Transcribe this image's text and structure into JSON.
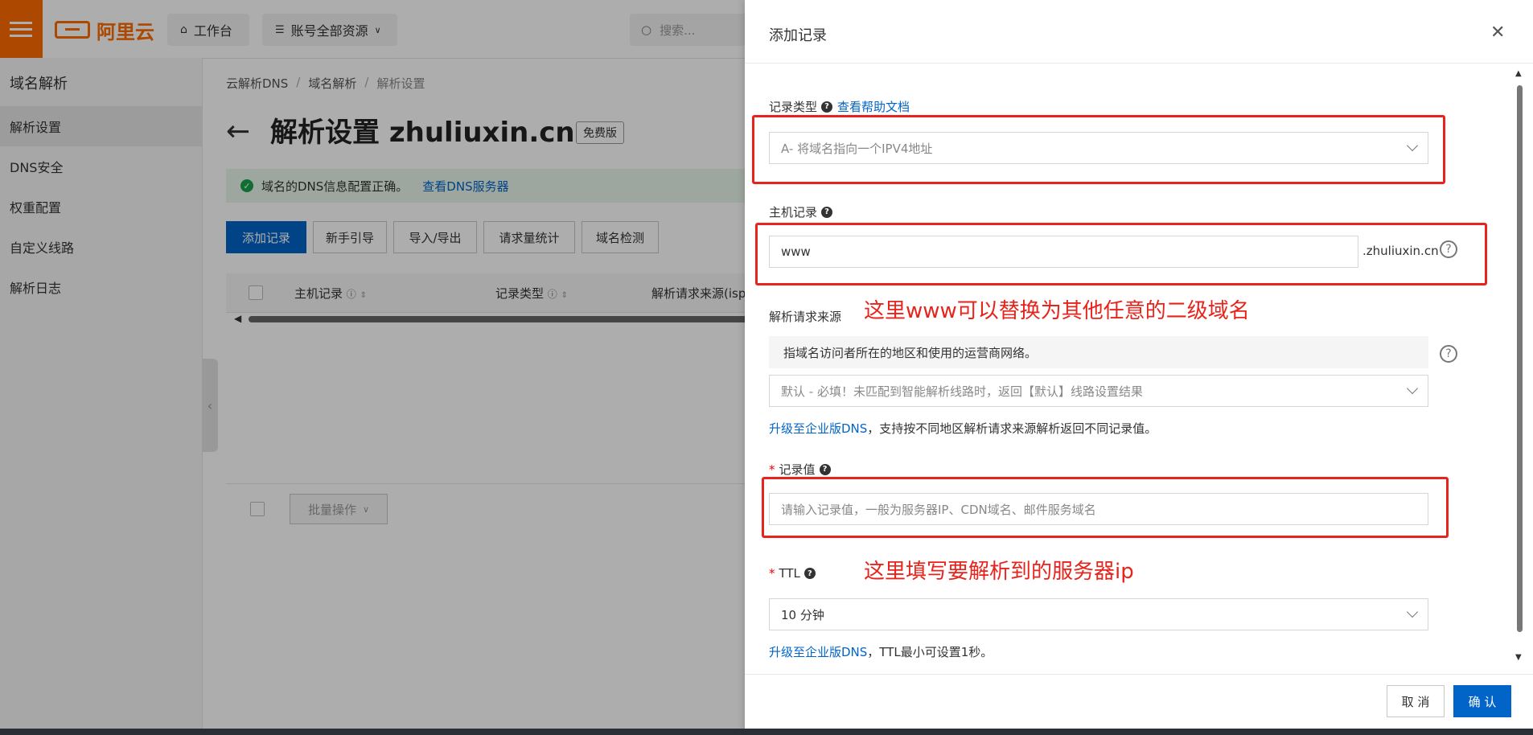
{
  "topbar": {
    "logo_text": "阿里云",
    "workbench": "工作台",
    "account_scope": "账号全部资源",
    "search_placeholder": "搜索..."
  },
  "sidebar": {
    "title": "域名解析",
    "items": [
      {
        "label": "解析设置",
        "active": true
      },
      {
        "label": "DNS安全",
        "active": false
      },
      {
        "label": "权重配置",
        "active": false
      },
      {
        "label": "自定义线路",
        "active": false
      },
      {
        "label": "解析日志",
        "active": false
      }
    ]
  },
  "main": {
    "breadcrumb": [
      "云解析DNS",
      "域名解析",
      "解析设置"
    ],
    "breadcrumb_sep": "/",
    "page_title": "解析设置 zhuliuxin.cn",
    "badge": "免费版",
    "notice": {
      "text": "域名的DNS信息配置正确。",
      "link": "查看DNS服务器"
    },
    "toolbar": [
      "添加记录",
      "新手引导",
      "导入/导出",
      "请求量统计",
      "域名检测"
    ],
    "table_headers": [
      "主机记录",
      "记录类型",
      "解析请求来源(isp)"
    ],
    "batch_action": "批量操作"
  },
  "drawer": {
    "title": "添加记录",
    "record_type": {
      "label": "记录类型",
      "help_link": "查看帮助文档",
      "value": "A- 将域名指向一个IPV4地址"
    },
    "host_record": {
      "label": "主机记录",
      "value": "www",
      "suffix": ".zhuliuxin.cn"
    },
    "annotation_host": "这里www可以替换为其他任意的二级域名",
    "request_source": {
      "label": "解析请求来源",
      "description": "指域名访问者所在的地区和使用的运营商网络。",
      "value": "默认 - 必填！未匹配到智能解析线路时，返回【默认】线路设置结果",
      "upgrade_link": "升级至企业版DNS",
      "upgrade_text": "，支持按不同地区解析请求来源解析返回不同记录值。"
    },
    "record_value": {
      "label": "记录值",
      "placeholder": "请输入记录值，一般为服务器IP、CDN域名、邮件服务域名"
    },
    "annotation_value": "这里填写要解析到的服务器ip",
    "ttl": {
      "label": "TTL",
      "value": "10 分钟",
      "upgrade_link": "升级至企业版DNS",
      "upgrade_text": "，TTL最小可设置1秒。"
    },
    "cancel": "取 消",
    "confirm": "确 认"
  },
  "colors": {
    "brand_orange": "#ff6a00",
    "primary_blue": "#0064c8",
    "annotation_red": "#e8231c"
  }
}
